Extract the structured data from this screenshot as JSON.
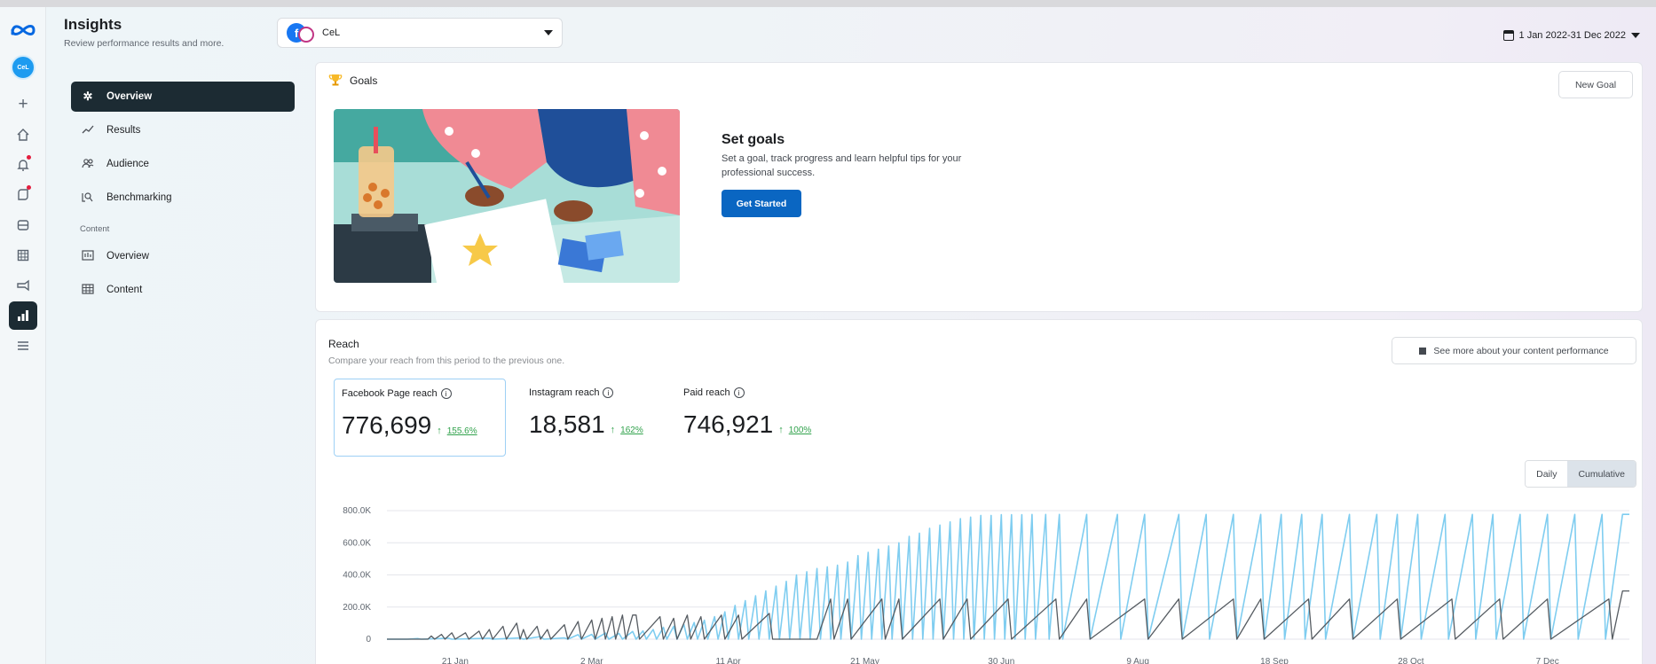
{
  "rail": {
    "avatar_label": "CeL",
    "items": [
      "create-icon",
      "home-icon",
      "notifications-icon",
      "activity-icon",
      "inbox-icon",
      "planner-icon",
      "ads-icon",
      "insights-icon",
      "menu-icon"
    ]
  },
  "header": {
    "title": "Insights",
    "subtitle": "Review performance results and more.",
    "account_name": "CeL",
    "date_range": "1 Jan 2022-31 Dec 2022"
  },
  "nav": {
    "items": [
      {
        "label": "Overview",
        "icon": "sparkle-icon",
        "active": true
      },
      {
        "label": "Results",
        "icon": "trend-icon"
      },
      {
        "label": "Audience",
        "icon": "people-icon"
      },
      {
        "label": "Benchmarking",
        "icon": "benchmark-icon"
      }
    ],
    "section_label": "Content",
    "content_items": [
      {
        "label": "Overview",
        "icon": "content-overview-icon"
      },
      {
        "label": "Content",
        "icon": "table-icon"
      }
    ]
  },
  "goals": {
    "title": "Goals",
    "new_goal": "New Goal",
    "heading": "Set goals",
    "description": "Set a goal, track progress and learn helpful tips for your professional success.",
    "cta": "Get Started"
  },
  "reach": {
    "title": "Reach",
    "subtitle": "Compare your reach from this period to the previous one.",
    "see_more": "See more about your content performance",
    "metrics": [
      {
        "label": "Facebook Page reach",
        "value": "776,699",
        "change": "155.6%"
      },
      {
        "label": "Instagram reach",
        "value": "18,581",
        "change": "162%"
      },
      {
        "label": "Paid reach",
        "value": "746,921",
        "change": "100%"
      }
    ],
    "toggle": {
      "daily": "Daily",
      "cumulative": "Cumulative"
    }
  },
  "colors": {
    "accent": "#0a66c2",
    "current_series": "#7fcdf0",
    "previous_series": "#555b61",
    "positive": "#31a24c"
  },
  "chart_data": {
    "type": "line",
    "y_ticks": [
      "0",
      "200.0K",
      "400.0K",
      "600.0K",
      "800.0K"
    ],
    "x_ticks": [
      "21 Jan",
      "2 Mar",
      "11 Apr",
      "21 May",
      "30 Jun",
      "9 Aug",
      "18 Sep",
      "28 Oct",
      "7 Dec"
    ],
    "ylim": [
      0,
      800000
    ],
    "grid": true,
    "series": [
      {
        "color": "#7fcdf0",
        "points": [
          [
            0,
            0
          ],
          [
            6,
            0
          ],
          [
            9,
            4000
          ],
          [
            10,
            0
          ],
          [
            18,
            6000
          ],
          [
            19,
            0
          ],
          [
            30,
            6000
          ],
          [
            31,
            0
          ],
          [
            39,
            8000
          ],
          [
            40,
            0
          ],
          [
            45,
            16000
          ],
          [
            46,
            0
          ],
          [
            52,
            8000
          ],
          [
            53,
            0
          ],
          [
            56,
            28000
          ],
          [
            57,
            0
          ],
          [
            60,
            30000
          ],
          [
            61,
            0
          ],
          [
            64,
            38000
          ],
          [
            65,
            0
          ],
          [
            68,
            36000
          ],
          [
            69,
            0
          ],
          [
            72,
            48000
          ],
          [
            73,
            0
          ],
          [
            75,
            52000
          ],
          [
            76,
            0
          ],
          [
            78,
            60000
          ],
          [
            79,
            0
          ],
          [
            81,
            74000
          ],
          [
            82,
            0
          ],
          [
            84,
            80000
          ],
          [
            85,
            0
          ],
          [
            87,
            92000
          ],
          [
            88,
            0
          ],
          [
            90,
            104000
          ],
          [
            91,
            0
          ],
          [
            93,
            118000
          ],
          [
            94,
            0
          ],
          [
            96,
            140000
          ],
          [
            97,
            0
          ],
          [
            99,
            170000
          ],
          [
            100,
            0
          ],
          [
            102,
            210000
          ],
          [
            103,
            0
          ],
          [
            105,
            240000
          ],
          [
            106,
            0
          ],
          [
            108,
            270000
          ],
          [
            109,
            0
          ],
          [
            111,
            300000
          ],
          [
            112,
            0
          ],
          [
            114,
            330000
          ],
          [
            115,
            0
          ],
          [
            117,
            360000
          ],
          [
            118,
            0
          ],
          [
            120,
            400000
          ],
          [
            121,
            0
          ],
          [
            123,
            420000
          ],
          [
            124,
            0
          ],
          [
            126,
            440000
          ],
          [
            127,
            0
          ],
          [
            129,
            450000
          ],
          [
            130,
            0
          ],
          [
            132,
            460000
          ],
          [
            133,
            0
          ],
          [
            135,
            480000
          ],
          [
            136,
            0
          ],
          [
            138,
            520000
          ],
          [
            139,
            0
          ],
          [
            141,
            540000
          ],
          [
            142,
            0
          ],
          [
            144,
            560000
          ],
          [
            145,
            0
          ],
          [
            147,
            580000
          ],
          [
            148,
            0
          ],
          [
            150,
            600000
          ],
          [
            151,
            0
          ],
          [
            153,
            640000
          ],
          [
            154,
            0
          ],
          [
            156,
            660000
          ],
          [
            157,
            0
          ],
          [
            159,
            690000
          ],
          [
            160,
            0
          ],
          [
            162,
            710000
          ],
          [
            163,
            0
          ],
          [
            165,
            730000
          ],
          [
            166,
            0
          ],
          [
            168,
            750000
          ],
          [
            169,
            0
          ],
          [
            171,
            760000
          ],
          [
            172,
            0
          ],
          [
            174,
            770000
          ],
          [
            175,
            0
          ],
          [
            177,
            770000
          ],
          [
            178,
            0
          ],
          [
            180,
            775000
          ],
          [
            181,
            0
          ],
          [
            183,
            775000
          ],
          [
            184,
            0
          ],
          [
            186,
            775000
          ],
          [
            187,
            0
          ],
          [
            189,
            776000
          ],
          [
            190,
            0
          ],
          [
            193,
            776000
          ],
          [
            194,
            0
          ],
          [
            197,
            776000
          ],
          [
            198,
            0
          ],
          [
            205,
            776000
          ],
          [
            206,
            0
          ],
          [
            214,
            776000
          ],
          [
            215,
            0
          ],
          [
            222,
            776000
          ],
          [
            223,
            0
          ],
          [
            232,
            776000
          ],
          [
            233,
            0
          ],
          [
            240,
            776000
          ],
          [
            241,
            0
          ],
          [
            248,
            776000
          ],
          [
            249,
            0
          ],
          [
            256,
            776000
          ],
          [
            257,
            0
          ],
          [
            262,
            776000
          ],
          [
            263,
            0
          ],
          [
            268,
            776000
          ],
          [
            269,
            0
          ],
          [
            274,
            776000
          ],
          [
            275,
            0
          ],
          [
            282,
            776000
          ],
          [
            283,
            0
          ],
          [
            290,
            776000
          ],
          [
            291,
            0
          ],
          [
            296,
            776000
          ],
          [
            297,
            0
          ],
          [
            302,
            776000
          ],
          [
            303,
            0
          ],
          [
            310,
            776000
          ],
          [
            311,
            0
          ],
          [
            318,
            776000
          ],
          [
            319,
            0
          ],
          [
            324,
            776000
          ],
          [
            325,
            0
          ],
          [
            332,
            776000
          ],
          [
            333,
            0
          ],
          [
            340,
            776000
          ],
          [
            341,
            0
          ],
          [
            348,
            776000
          ],
          [
            349,
            0
          ],
          [
            356,
            776000
          ],
          [
            357,
            0
          ],
          [
            362,
            776699
          ],
          [
            364,
            776699
          ]
        ]
      },
      {
        "color": "#555b61",
        "points": [
          [
            0,
            0
          ],
          [
            12,
            0
          ],
          [
            13,
            20000
          ],
          [
            14,
            0
          ],
          [
            16,
            30000
          ],
          [
            17,
            0
          ],
          [
            19,
            40000
          ],
          [
            20,
            0
          ],
          [
            23,
            40000
          ],
          [
            24,
            0
          ],
          [
            27,
            50000
          ],
          [
            28,
            0
          ],
          [
            30,
            60000
          ],
          [
            31,
            0
          ],
          [
            34,
            80000
          ],
          [
            35,
            0
          ],
          [
            38,
            100000
          ],
          [
            39,
            0
          ],
          [
            40,
            60000
          ],
          [
            41,
            0
          ],
          [
            44,
            80000
          ],
          [
            45,
            0
          ],
          [
            47,
            60000
          ],
          [
            48,
            0
          ],
          [
            52,
            90000
          ],
          [
            53,
            0
          ],
          [
            56,
            110000
          ],
          [
            57,
            0
          ],
          [
            60,
            120000
          ],
          [
            61,
            0
          ],
          [
            63,
            130000
          ],
          [
            64,
            0
          ],
          [
            66,
            140000
          ],
          [
            67,
            0
          ],
          [
            69,
            150000
          ],
          [
            70,
            0
          ],
          [
            72,
            150000
          ],
          [
            73,
            150000
          ],
          [
            74,
            0
          ],
          [
            80,
            140000
          ],
          [
            81,
            0
          ],
          [
            84,
            130000
          ],
          [
            85,
            0
          ],
          [
            88,
            150000
          ],
          [
            89,
            0
          ],
          [
            92,
            140000
          ],
          [
            93,
            0
          ],
          [
            98,
            150000
          ],
          [
            99,
            0
          ],
          [
            103,
            150000
          ],
          [
            104,
            0
          ],
          [
            112,
            160000
          ],
          [
            113,
            0
          ],
          [
            124,
            0
          ],
          [
            126,
            0
          ],
          [
            130,
            250000
          ],
          [
            131,
            0
          ],
          [
            135,
            250000
          ],
          [
            136,
            0
          ],
          [
            145,
            250000
          ],
          [
            146,
            0
          ],
          [
            150,
            250000
          ],
          [
            151,
            0
          ],
          [
            162,
            250000
          ],
          [
            163,
            0
          ],
          [
            170,
            250000
          ],
          [
            171,
            0
          ],
          [
            182,
            250000
          ],
          [
            183,
            0
          ],
          [
            196,
            250000
          ],
          [
            197,
            0
          ],
          [
            205,
            250000
          ],
          [
            206,
            0
          ],
          [
            222,
            250000
          ],
          [
            223,
            0
          ],
          [
            232,
            250000
          ],
          [
            233,
            0
          ],
          [
            248,
            250000
          ],
          [
            249,
            0
          ],
          [
            256,
            250000
          ],
          [
            257,
            0
          ],
          [
            270,
            250000
          ],
          [
            271,
            0
          ],
          [
            282,
            250000
          ],
          [
            283,
            0
          ],
          [
            296,
            250000
          ],
          [
            297,
            0
          ],
          [
            312,
            250000
          ],
          [
            313,
            0
          ],
          [
            326,
            250000
          ],
          [
            327,
            0
          ],
          [
            340,
            250000
          ],
          [
            341,
            0
          ],
          [
            358,
            250000
          ],
          [
            359,
            0
          ],
          [
            362,
            300000
          ],
          [
            364,
            300000
          ]
        ]
      }
    ]
  }
}
